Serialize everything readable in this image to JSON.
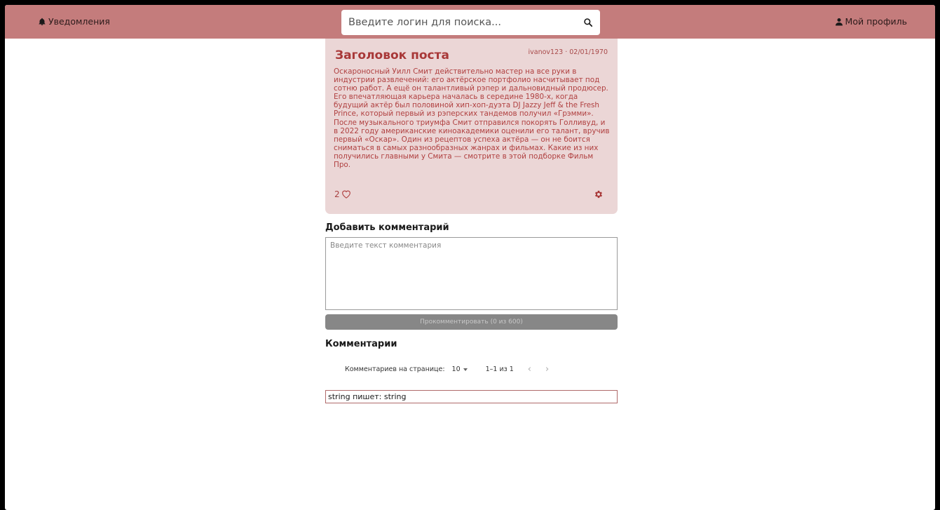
{
  "header": {
    "notifications_label": "Уведомления",
    "search_placeholder": "Введите логин для поиска...",
    "profile_label": "Мой профиль"
  },
  "post": {
    "title": "Заголовок поста",
    "meta": "ivanov123 · 02/01/1970",
    "body": "Оскароносный Уилл Смит действительно мастер на все руки в индустрии развлечений: его актёрское портфолио насчитывает под сотню работ. А ещё он талантливый рэпер и дальновидный продюсер. Его впечатляющая карьера началась в середине 1980-х, когда будущий актёр был половиной хип-хоп-дуэта DJ Jazzy Jeff & the Fresh Prince, который первый из рэперских тандемов получил «Грэмми». После музыкального триумфа Смит отправился покорять Голливуд, и в 2022 году американские киноакадемики оценили его талант, вручив первый «Оскар». Один из рецептов успеха актёра — он не боится сниматься в самых разнообразных жанрах и фильмах. Какие из них получились главными у Смита — смотрите в этой подборке Фильм Про.",
    "likes": "2"
  },
  "add_comment": {
    "heading": "Добавить комментарий",
    "placeholder": "Введите текст комментария",
    "submit_label": "Прокомментировать (0 из 600)"
  },
  "comments": {
    "heading": "Комментарии",
    "per_page_label": "Комментариев на странице:",
    "per_page_value": "10",
    "range_label": "1–1 из 1",
    "prev_arrow": "‹",
    "next_arrow": "›",
    "items": [
      {
        "author": "string пишет:",
        "text": "string"
      }
    ]
  },
  "colors": {
    "header_bg": "#c47c7c",
    "post_bg": "#ebd6d6",
    "accent": "#a83838"
  }
}
